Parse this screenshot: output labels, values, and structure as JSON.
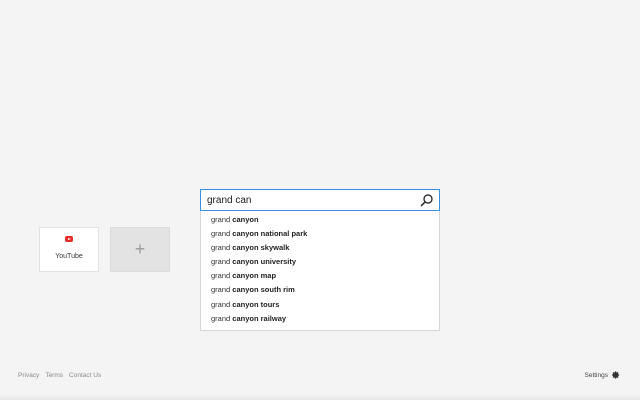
{
  "tiles": [
    {
      "label": "YouTube",
      "icon": "youtube-icon",
      "accent": "#e52d27"
    },
    {
      "label": "",
      "icon": "plus-icon"
    }
  ],
  "add_tile": {
    "symbol": "+"
  },
  "search": {
    "value": "grand can",
    "placeholder": "",
    "border_color": "#3a8ee6",
    "icon": "search-icon"
  },
  "suggestions": [
    {
      "prefix": "grand ",
      "completion": "canyon"
    },
    {
      "prefix": "grand ",
      "completion": "canyon national park"
    },
    {
      "prefix": "grand ",
      "completion": "canyon skywalk"
    },
    {
      "prefix": "grand ",
      "completion": "canyon university"
    },
    {
      "prefix": "grand ",
      "completion": "canyon map"
    },
    {
      "prefix": "grand ",
      "completion": "canyon south rim"
    },
    {
      "prefix": "grand ",
      "completion": "canyon tours"
    },
    {
      "prefix": "grand ",
      "completion": "canyon railway"
    }
  ],
  "footer": {
    "links": [
      "Privacy",
      "Terms",
      "Contact Us"
    ],
    "settings_label": "Settings",
    "settings_icon": "gear-icon"
  }
}
